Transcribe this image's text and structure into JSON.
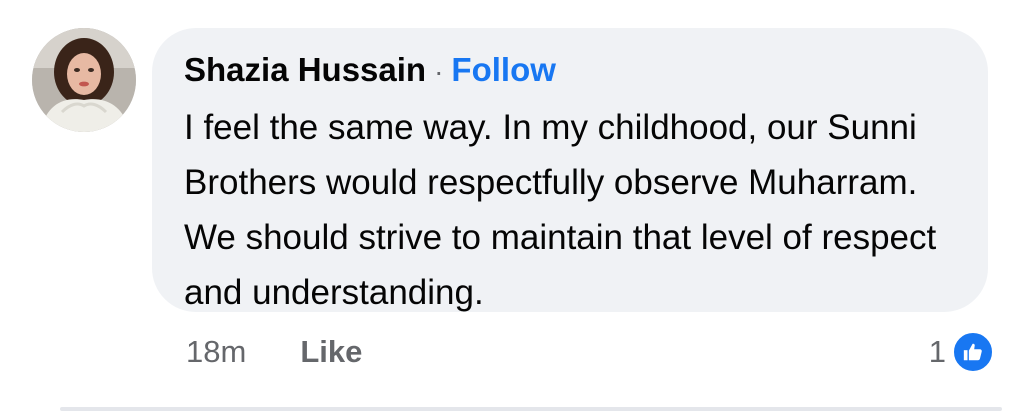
{
  "comment": {
    "author": "Shazia Hussain",
    "separator": "·",
    "follow_label": "Follow",
    "text": "I feel the same way. In my childhood, our Sunni Brothers would respectfully observe Muharram. We should strive to maintain that level of respect and understanding.",
    "timestamp": "18m",
    "like_label": "Like",
    "reaction_count": "1",
    "reaction_icon": "thumbs-up-icon"
  },
  "colors": {
    "bubble_bg": "#f0f2f5",
    "accent": "#1877f2",
    "text": "#050505",
    "secondary_text": "#65676b"
  }
}
